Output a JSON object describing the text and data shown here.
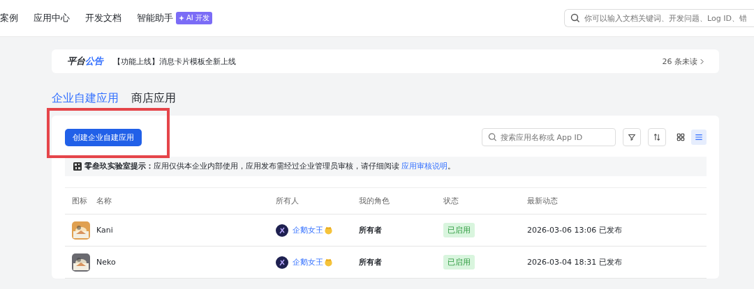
{
  "nav": {
    "items": [
      "案例",
      "应用中心",
      "开发文档",
      "智能助手"
    ],
    "badge": "AI 开发",
    "search": {
      "placeholder": "你可以输入文档关键词、开发问题、Log ID、错"
    }
  },
  "notice": {
    "title_a": "平台",
    "title_b": "公告",
    "text": "【功能上线】消息卡片模板全新上线",
    "unread": "26 条未读"
  },
  "tabs": [
    {
      "label": "企业自建应用",
      "selected": true
    },
    {
      "label": "商店应用",
      "selected": false
    }
  ],
  "toolbar": {
    "create_button": "创建企业自建应用",
    "search": {
      "placeholder": "搜索应用名称或 App ID"
    },
    "views": [
      {
        "kind": "grid",
        "selected": false
      },
      {
        "kind": "list",
        "selected": true
      }
    ]
  },
  "tip": {
    "label": "零叁玖实验室提示：",
    "text": "应用仅供本企业内部使用，应用发布需经过企业管理员审核，请仔细阅读",
    "link": "应用审核说明",
    "end": "。"
  },
  "table": {
    "columns": [
      "图标",
      "名称",
      "所有人",
      "我的角色",
      "状态",
      "最新动态"
    ],
    "rows": [
      {
        "name": "Kani",
        "owner": "企鹅女王",
        "role": "所有者",
        "status": "已启用",
        "latest": "2026-03-06 13:06 已发布"
      },
      {
        "name": "Neko",
        "owner": "企鹅女王",
        "role": "所有者",
        "status": "已启用",
        "latest": "2026-03-04 18:31 已发布"
      }
    ]
  }
}
